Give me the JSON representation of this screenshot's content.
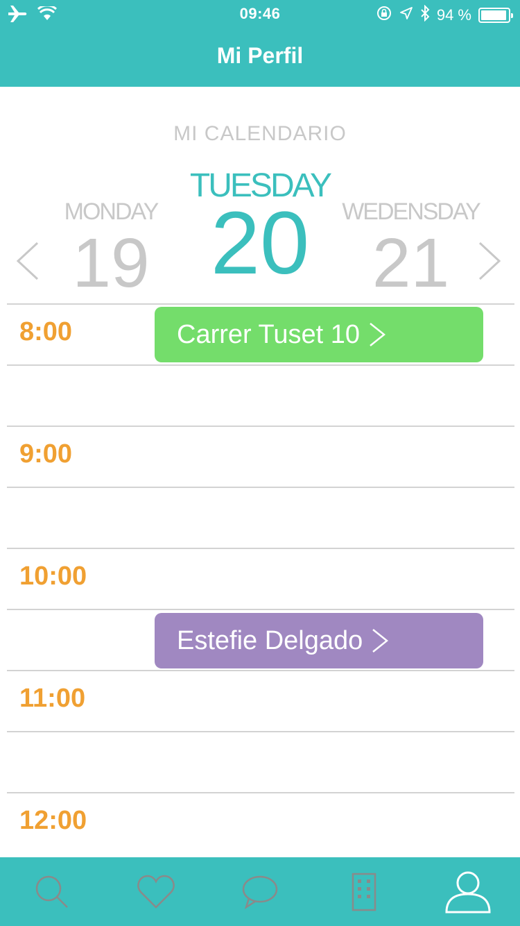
{
  "status_bar": {
    "time": "09:46",
    "battery_text": "94 %",
    "battery_level": 0.94,
    "icons": [
      "airplane-icon",
      "wifi-icon",
      "rotation-lock-icon",
      "location-icon",
      "bluetooth-icon",
      "battery-icon"
    ]
  },
  "header": {
    "title": "Mi Perfil"
  },
  "calendar": {
    "label": "MI CALENDARIO",
    "prev_day": {
      "name": "MONDAY",
      "number": "19"
    },
    "current_day": {
      "name": "TUESDAY",
      "number": "20"
    },
    "next_day": {
      "name": "WEDENSDAY",
      "number": "21"
    }
  },
  "timeline": {
    "hours": [
      "8:00",
      "9:00",
      "10:00",
      "11:00",
      "12:00"
    ],
    "events": [
      {
        "label": "Carrer Tuset 10",
        "color": "#74dd6b"
      },
      {
        "label": "Estefie Delgado",
        "color": "#a088c1"
      }
    ]
  },
  "tabbar": {
    "tabs": [
      "search-icon",
      "heart-icon",
      "chat-icon",
      "building-icon",
      "profile-icon"
    ],
    "active": "profile-icon"
  },
  "colors": {
    "primary": "#3bbfbd",
    "hour_text": "#f0a032",
    "inactive_tab_icon": "#8a8a8a",
    "muted_text": "#c8c8c8"
  }
}
